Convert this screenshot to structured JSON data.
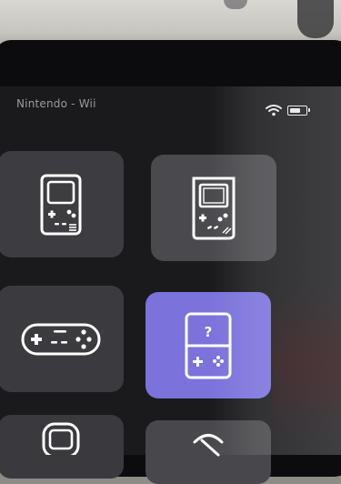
{
  "status_bar": {
    "title": "Nintendo - Wii",
    "wifi_icon": "wifi-icon",
    "battery_icon": "battery-icon",
    "battery_level": 0.7
  },
  "tiles": [
    {
      "icon": "game-boy-color-icon",
      "selected": false
    },
    {
      "icon": "game-boy-icon",
      "selected": false
    },
    {
      "icon": "snes-controller-icon",
      "selected": false
    },
    {
      "icon": "unknown-handheld-icon",
      "selected": true,
      "icon_text": "?"
    },
    {
      "icon": "game-boy-advance-icon",
      "selected": false
    },
    {
      "icon": "stylus-icon",
      "selected": false
    }
  ],
  "colors": {
    "screen_bg": "#1a1a1d",
    "tile_bg": "#3a393d",
    "selected_tile": "#7b72dc",
    "icon_stroke": "#ffffff"
  }
}
